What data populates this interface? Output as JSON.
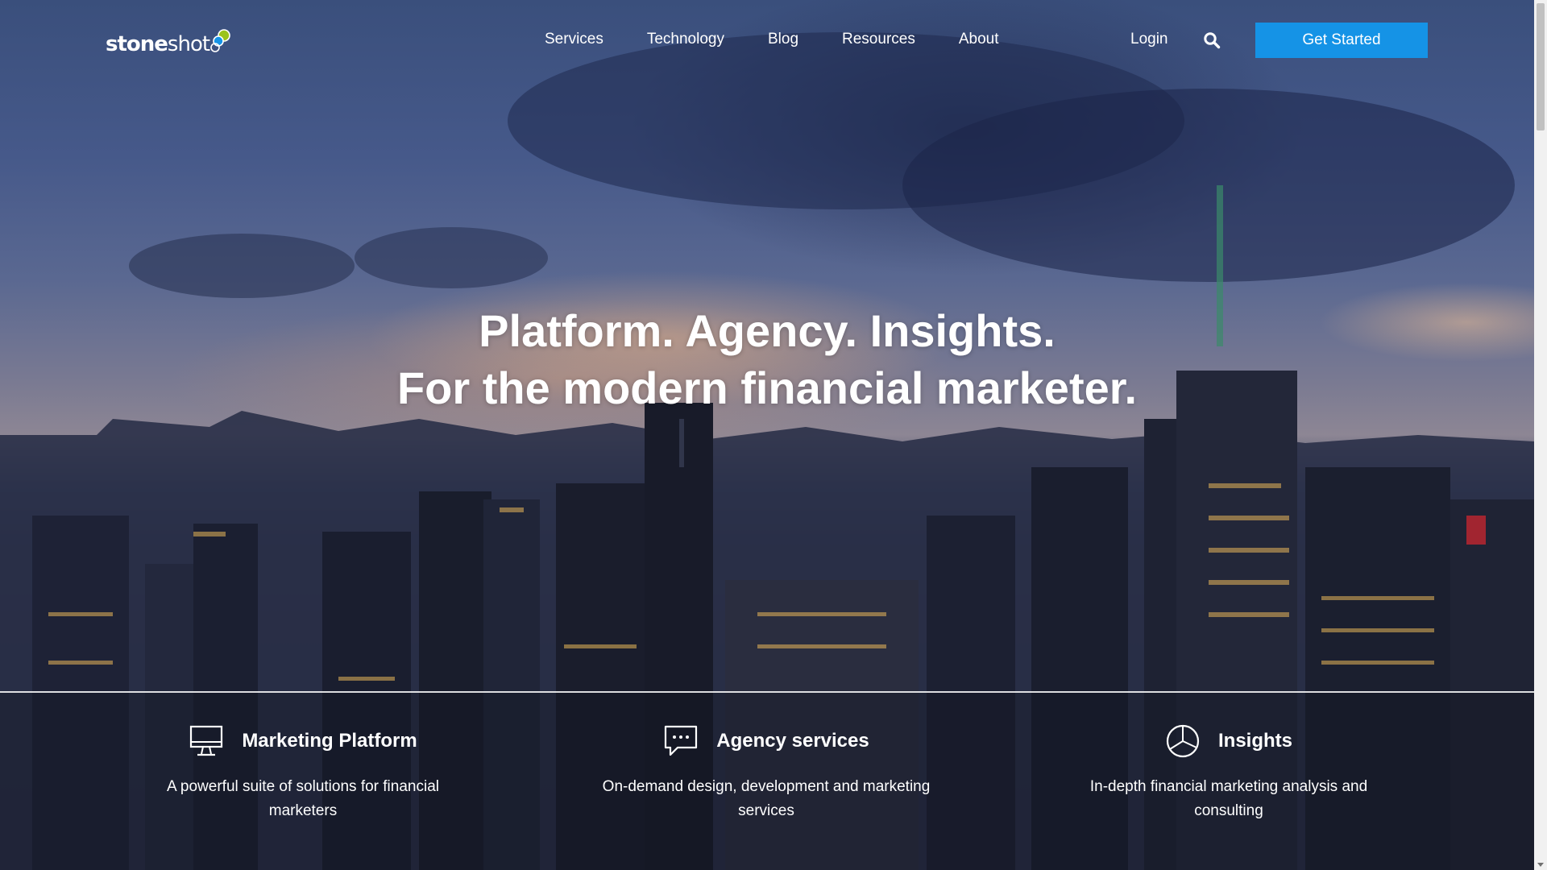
{
  "header": {
    "logo": {
      "text_bold": "stone",
      "text_light": "shot"
    },
    "nav": [
      "Services",
      "Technology",
      "Blog",
      "Resources",
      "About"
    ],
    "login_label": "Login",
    "search_icon": "search-icon",
    "cta_label": "Get Started"
  },
  "hero": {
    "line1": "Platform. Agency. Insights.",
    "line2": "For the modern financial marketer."
  },
  "features": [
    {
      "icon": "monitor-icon",
      "title": "Marketing Platform",
      "desc": "A powerful suite of solutions for financial marketers"
    },
    {
      "icon": "chat-bubble-icon",
      "title": "Agency services",
      "desc": "On-demand design, development and marketing services"
    },
    {
      "icon": "pie-chart-icon",
      "title": "Insights",
      "desc": "In-depth financial marketing analysis and consulting"
    }
  ],
  "colors": {
    "cta": "#1593e6",
    "logo_dot_green": "#9bc31c",
    "logo_dot_blue": "#1593e6"
  }
}
